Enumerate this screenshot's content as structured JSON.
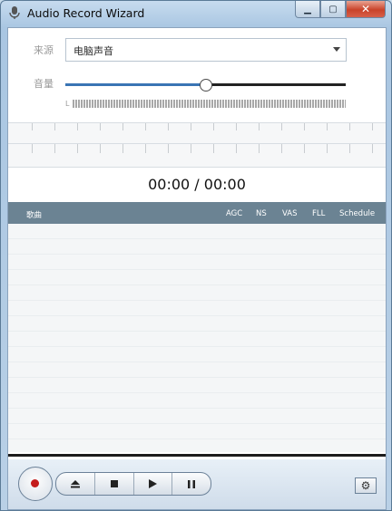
{
  "window": {
    "title": "Audio Record Wizard"
  },
  "form": {
    "source_label": "来源",
    "source_value": "电脑声音",
    "volume_label": "音量",
    "volume_fraction": 0.5,
    "meter_label": "L"
  },
  "player": {
    "time": "00:00 / 00:00"
  },
  "table": {
    "columns": [
      "歌曲",
      "AGC",
      "NS",
      "VAS",
      "FLL",
      "Schedule"
    ]
  },
  "icons": {
    "app": "microphone-icon",
    "record": "record-icon",
    "eject": "eject-icon",
    "stop": "stop-icon",
    "play": "play-icon",
    "pause": "pause-icon",
    "settings": "gear-icon"
  },
  "colors": {
    "table_header": "#6b8393",
    "slider_fill": "#3a75b4",
    "record": "#c41c1c"
  }
}
